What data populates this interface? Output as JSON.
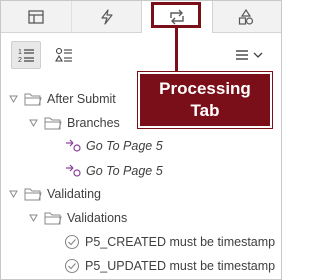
{
  "tabs": [
    {
      "icon": "layout-icon"
    },
    {
      "icon": "lightning-icon"
    },
    {
      "icon": "processing-icon",
      "selected": true
    },
    {
      "icon": "shapes-icon"
    }
  ],
  "toolbar": {
    "view_tree_icon": "numbered-list-icon",
    "view_components_icon": "shapes-list-icon",
    "menu_icon": "hamburger-menu-icon"
  },
  "tree": {
    "after_submit": "After Submit",
    "branches": "Branches",
    "branch_1": "Go To Page 5",
    "branch_2": "Go To Page 5",
    "validating": "Validating",
    "validations": "Validations",
    "validation_1": "P5_CREATED must be timestamp",
    "validation_2": "P5_UPDATED must be timestamp"
  },
  "callout": {
    "line1": "Processing",
    "line2": "Tab"
  },
  "colors": {
    "accent": "#7a0f1a",
    "branch_icon": "#8a3d9a"
  }
}
